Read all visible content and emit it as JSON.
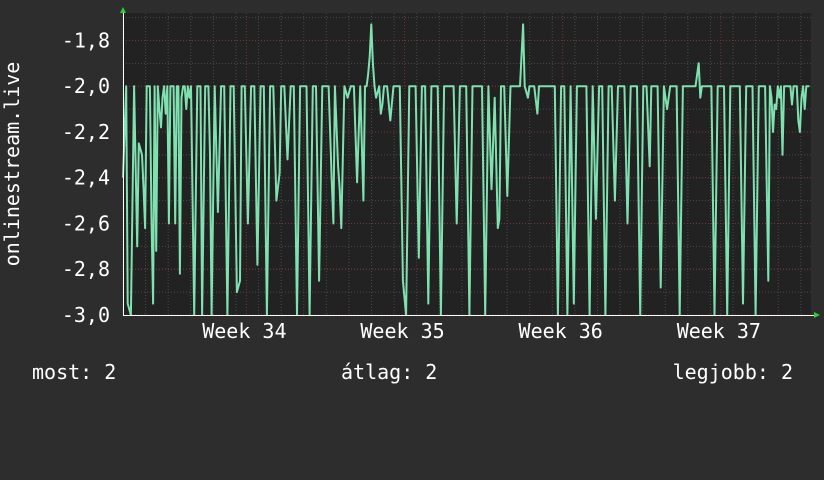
{
  "colors": {
    "background": "#2d2d2d",
    "plot_background": "#222222",
    "major_grid": "#7a3232",
    "minor_grid": "#4a4a4a",
    "line": "#7fe0b0",
    "axis_arrow": "#2ecc40",
    "text": "#ffffff"
  },
  "legend": {
    "current": "most: 2",
    "average": "átlag: 2",
    "maximum": "legjobb: 2"
  },
  "chart_data": {
    "type": "line",
    "title": "",
    "ylabel": "onlinestream.live",
    "xlabel": "",
    "grid": true,
    "ylim": [
      -3.0,
      -1.68
    ],
    "y_ticks": [
      -3.0,
      -2.8,
      -2.6,
      -2.4,
      -2.2,
      -2.0,
      -1.8
    ],
    "y_tick_labels": [
      "-3,0",
      "-2,8",
      "-2,6",
      "-2,4",
      "-2,2",
      "-2,0",
      "-1,8"
    ],
    "xlim": [
      0,
      4.35
    ],
    "x_ticks": [
      0.78,
      1.78,
      2.78,
      3.78
    ],
    "x_tick_labels": [
      "Week 34",
      "Week 35",
      "Week 36",
      "Week 37"
    ],
    "x_unit": "weeks from plot start",
    "series": [
      {
        "values": [
          [
            0.0,
            -2.4
          ],
          [
            0.02,
            -2.0
          ],
          [
            0.03,
            -2.95
          ],
          [
            0.05,
            -3.0
          ],
          [
            0.07,
            -2.0
          ],
          [
            0.09,
            -2.7
          ],
          [
            0.1,
            -2.25
          ],
          [
            0.12,
            -2.3
          ],
          [
            0.13,
            -2.45
          ],
          [
            0.14,
            -2.62
          ],
          [
            0.15,
            -2.0
          ],
          [
            0.17,
            -2.0
          ],
          [
            0.18,
            -2.58
          ],
          [
            0.19,
            -2.95
          ],
          [
            0.2,
            -2.0
          ],
          [
            0.21,
            -2.72
          ],
          [
            0.22,
            -2.0
          ],
          [
            0.23,
            -2.1
          ],
          [
            0.24,
            -2.18
          ],
          [
            0.25,
            -2.05
          ],
          [
            0.26,
            -2.0
          ],
          [
            0.27,
            -2.12
          ],
          [
            0.28,
            -2.0
          ],
          [
            0.29,
            -2.6
          ],
          [
            0.3,
            -2.0
          ],
          [
            0.31,
            -2.0
          ],
          [
            0.32,
            -2.0
          ],
          [
            0.33,
            -2.6
          ],
          [
            0.34,
            -2.0
          ],
          [
            0.35,
            -2.0
          ],
          [
            0.36,
            -2.82
          ],
          [
            0.37,
            -2.05
          ],
          [
            0.38,
            -2.0
          ],
          [
            0.39,
            -2.0
          ],
          [
            0.4,
            -2.1
          ],
          [
            0.41,
            -2.0
          ],
          [
            0.42,
            -2.05
          ],
          [
            0.43,
            -2.0
          ],
          [
            0.45,
            -3.0
          ],
          [
            0.47,
            -2.0
          ],
          [
            0.49,
            -2.0
          ],
          [
            0.5,
            -3.0
          ],
          [
            0.52,
            -2.0
          ],
          [
            0.54,
            -2.0
          ],
          [
            0.55,
            -2.3
          ],
          [
            0.56,
            -3.0
          ],
          [
            0.58,
            -2.0
          ],
          [
            0.6,
            -2.55
          ],
          [
            0.62,
            -2.0
          ],
          [
            0.64,
            -2.0
          ],
          [
            0.66,
            -3.0
          ],
          [
            0.68,
            -2.0
          ],
          [
            0.7,
            -2.0
          ],
          [
            0.72,
            -2.9
          ],
          [
            0.74,
            -2.85
          ],
          [
            0.75,
            -2.0
          ],
          [
            0.77,
            -2.0
          ],
          [
            0.79,
            -2.6
          ],
          [
            0.81,
            -2.0
          ],
          [
            0.83,
            -2.0
          ],
          [
            0.85,
            -2.78
          ],
          [
            0.87,
            -2.0
          ],
          [
            0.89,
            -2.0
          ],
          [
            0.91,
            -3.0
          ],
          [
            0.93,
            -2.0
          ],
          [
            0.95,
            -2.0
          ],
          [
            0.97,
            -2.5
          ],
          [
            0.99,
            -2.38
          ],
          [
            1.0,
            -2.0
          ],
          [
            1.02,
            -2.0
          ],
          [
            1.04,
            -2.32
          ],
          [
            1.06,
            -2.0
          ],
          [
            1.08,
            -2.0
          ],
          [
            1.1,
            -3.0
          ],
          [
            1.12,
            -2.0
          ],
          [
            1.14,
            -2.0
          ],
          [
            1.16,
            -2.0
          ],
          [
            1.18,
            -3.0
          ],
          [
            1.2,
            -2.0
          ],
          [
            1.22,
            -2.0
          ],
          [
            1.24,
            -2.85
          ],
          [
            1.26,
            -2.0
          ],
          [
            1.28,
            -2.0
          ],
          [
            1.3,
            -2.0
          ],
          [
            1.32,
            -2.42
          ],
          [
            1.33,
            -2.6
          ],
          [
            1.34,
            -2.0
          ],
          [
            1.36,
            -2.35
          ],
          [
            1.37,
            -2.45
          ],
          [
            1.38,
            -2.62
          ],
          [
            1.4,
            -2.0
          ],
          [
            1.42,
            -2.05
          ],
          [
            1.44,
            -2.0
          ],
          [
            1.46,
            -2.0
          ],
          [
            1.48,
            -2.42
          ],
          [
            1.5,
            -2.0
          ],
          [
            1.52,
            -2.5
          ],
          [
            1.53,
            -2.0
          ],
          [
            1.54,
            -2.0
          ],
          [
            1.55,
            -1.95
          ],
          [
            1.56,
            -1.87
          ],
          [
            1.57,
            -1.73
          ],
          [
            1.58,
            -1.9
          ],
          [
            1.59,
            -2.0
          ],
          [
            1.6,
            -2.05
          ],
          [
            1.62,
            -2.0
          ],
          [
            1.63,
            -2.12
          ],
          [
            1.64,
            -2.08
          ],
          [
            1.65,
            -2.0
          ],
          [
            1.67,
            -2.0
          ],
          [
            1.69,
            -2.15
          ],
          [
            1.71,
            -2.0
          ],
          [
            1.73,
            -2.0
          ],
          [
            1.75,
            -2.0
          ],
          [
            1.77,
            -2.85
          ],
          [
            1.79,
            -3.0
          ],
          [
            1.81,
            -2.0
          ],
          [
            1.83,
            -2.0
          ],
          [
            1.85,
            -2.0
          ],
          [
            1.87,
            -2.75
          ],
          [
            1.89,
            -2.0
          ],
          [
            1.91,
            -2.0
          ],
          [
            1.93,
            -2.95
          ],
          [
            1.95,
            -2.0
          ],
          [
            1.97,
            -2.0
          ],
          [
            1.99,
            -2.0
          ],
          [
            2.01,
            -3.0
          ],
          [
            2.03,
            -2.0
          ],
          [
            2.05,
            -2.0
          ],
          [
            2.07,
            -2.0
          ],
          [
            2.09,
            -2.0
          ],
          [
            2.11,
            -2.6
          ],
          [
            2.13,
            -2.0
          ],
          [
            2.15,
            -2.0
          ],
          [
            2.17,
            -2.0
          ],
          [
            2.19,
            -3.0
          ],
          [
            2.21,
            -2.0
          ],
          [
            2.23,
            -2.0
          ],
          [
            2.25,
            -2.0
          ],
          [
            2.27,
            -2.0
          ],
          [
            2.29,
            -3.0
          ],
          [
            2.31,
            -2.0
          ],
          [
            2.33,
            -2.45
          ],
          [
            2.35,
            -2.05
          ],
          [
            2.37,
            -2.62
          ],
          [
            2.38,
            -2.58
          ],
          [
            2.39,
            -2.0
          ],
          [
            2.41,
            -2.0
          ],
          [
            2.43,
            -2.48
          ],
          [
            2.45,
            -2.0
          ],
          [
            2.47,
            -2.0
          ],
          [
            2.49,
            -2.0
          ],
          [
            2.51,
            -2.0
          ],
          [
            2.53,
            -1.73
          ],
          [
            2.54,
            -2.0
          ],
          [
            2.56,
            -2.05
          ],
          [
            2.57,
            -2.0
          ],
          [
            2.58,
            -2.0
          ],
          [
            2.6,
            -2.0
          ],
          [
            2.62,
            -2.12
          ],
          [
            2.63,
            -2.0
          ],
          [
            2.65,
            -2.0
          ],
          [
            2.67,
            -2.0
          ],
          [
            2.69,
            -2.0
          ],
          [
            2.71,
            -2.0
          ],
          [
            2.73,
            -2.0
          ],
          [
            2.75,
            -3.0
          ],
          [
            2.77,
            -2.0
          ],
          [
            2.79,
            -2.0
          ],
          [
            2.81,
            -3.0
          ],
          [
            2.83,
            -2.0
          ],
          [
            2.85,
            -2.95
          ],
          [
            2.87,
            -2.0
          ],
          [
            2.89,
            -2.0
          ],
          [
            2.91,
            -2.0
          ],
          [
            2.93,
            -2.0
          ],
          [
            2.95,
            -3.0
          ],
          [
            2.97,
            -2.0
          ],
          [
            2.99,
            -2.58
          ],
          [
            3.01,
            -2.0
          ],
          [
            3.03,
            -2.0
          ],
          [
            3.05,
            -3.0
          ],
          [
            3.07,
            -2.0
          ],
          [
            3.09,
            -2.0
          ],
          [
            3.11,
            -2.5
          ],
          [
            3.13,
            -2.0
          ],
          [
            3.15,
            -2.0
          ],
          [
            3.17,
            -2.0
          ],
          [
            3.19,
            -2.6
          ],
          [
            3.21,
            -2.0
          ],
          [
            3.23,
            -2.0
          ],
          [
            3.25,
            -2.0
          ],
          [
            3.27,
            -3.0
          ],
          [
            3.29,
            -2.0
          ],
          [
            3.31,
            -2.0
          ],
          [
            3.33,
            -2.35
          ],
          [
            3.34,
            -2.0
          ],
          [
            3.36,
            -2.0
          ],
          [
            3.38,
            -2.0
          ],
          [
            3.4,
            -2.88
          ],
          [
            3.42,
            -2.0
          ],
          [
            3.44,
            -2.1
          ],
          [
            3.46,
            -2.0
          ],
          [
            3.48,
            -2.0
          ],
          [
            3.5,
            -2.0
          ],
          [
            3.52,
            -3.0
          ],
          [
            3.54,
            -2.0
          ],
          [
            3.56,
            -2.0
          ],
          [
            3.58,
            -2.0
          ],
          [
            3.6,
            -2.0
          ],
          [
            3.62,
            -2.0
          ],
          [
            3.64,
            -1.9
          ],
          [
            3.65,
            -2.05
          ],
          [
            3.66,
            -2.0
          ],
          [
            3.68,
            -2.0
          ],
          [
            3.7,
            -2.0
          ],
          [
            3.72,
            -2.0
          ],
          [
            3.74,
            -3.0
          ],
          [
            3.76,
            -2.0
          ],
          [
            3.78,
            -2.0
          ],
          [
            3.8,
            -2.0
          ],
          [
            3.82,
            -3.0
          ],
          [
            3.84,
            -2.0
          ],
          [
            3.86,
            -2.0
          ],
          [
            3.88,
            -2.0
          ],
          [
            3.9,
            -2.0
          ],
          [
            3.92,
            -2.95
          ],
          [
            3.94,
            -2.0
          ],
          [
            3.96,
            -2.0
          ],
          [
            3.98,
            -2.0
          ],
          [
            4.0,
            -3.0
          ],
          [
            4.02,
            -2.0
          ],
          [
            4.04,
            -2.0
          ],
          [
            4.06,
            -2.0
          ],
          [
            4.08,
            -2.85
          ],
          [
            4.09,
            -2.0
          ],
          [
            4.1,
            -2.05
          ],
          [
            4.11,
            -2.2
          ],
          [
            4.12,
            -2.08
          ],
          [
            4.13,
            -2.1
          ],
          [
            4.14,
            -2.0
          ],
          [
            4.15,
            -2.05
          ],
          [
            4.16,
            -2.0
          ],
          [
            4.17,
            -2.3
          ],
          [
            4.18,
            -2.0
          ],
          [
            4.19,
            -2.0
          ],
          [
            4.2,
            -2.0
          ],
          [
            4.22,
            -2.0
          ],
          [
            4.23,
            -2.08
          ],
          [
            4.24,
            -2.0
          ],
          [
            4.25,
            -2.0
          ],
          [
            4.26,
            -2.0
          ],
          [
            4.27,
            -2.15
          ],
          [
            4.28,
            -2.2
          ],
          [
            4.29,
            -2.05
          ],
          [
            4.3,
            -2.0
          ],
          [
            4.31,
            -2.1
          ],
          [
            4.32,
            -2.0
          ],
          [
            4.33,
            -2.0
          ],
          [
            4.34,
            -2.0
          ]
        ]
      }
    ]
  }
}
